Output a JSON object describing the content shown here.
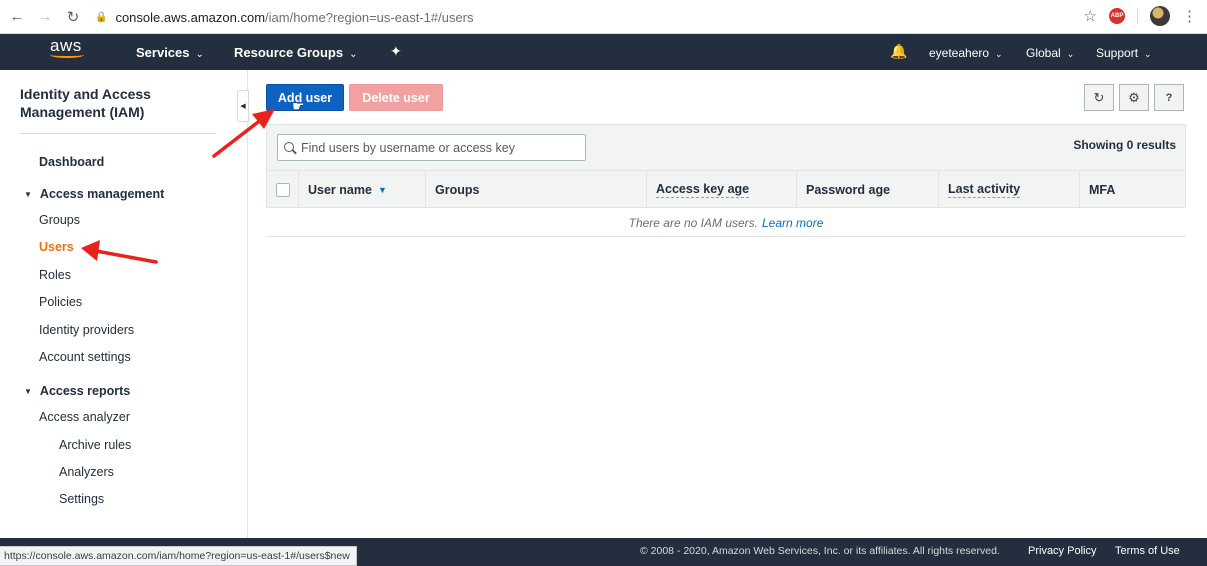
{
  "browser": {
    "url_host": "console.aws.amazon.com",
    "url_path": "/iam/home?region=us-east-1#/users",
    "status_url": "https://console.aws.amazon.com/iam/home?region=us-east-1#/users$new",
    "abp_label": "ABP"
  },
  "nav": {
    "logo": "aws",
    "services": "Services",
    "resource_groups": "Resource Groups",
    "account": "eyeteahero",
    "region": "Global",
    "support": "Support"
  },
  "sidebar": {
    "title": "Identity and Access Management (IAM)",
    "dashboard": "Dashboard",
    "access_management": "Access management",
    "items": [
      "Groups",
      "Users",
      "Roles",
      "Policies",
      "Identity providers",
      "Account settings"
    ],
    "access_reports": "Access reports",
    "analyzer": "Access analyzer",
    "analyzer_items": [
      "Archive rules",
      "Analyzers",
      "Settings"
    ],
    "active_item": "Users"
  },
  "toolbar": {
    "add_user": "Add user",
    "delete_user": "Delete user"
  },
  "search": {
    "placeholder": "Find users by username or access key"
  },
  "results": "Showing 0 results",
  "table": {
    "columns": [
      "User name",
      "Groups",
      "Access key age",
      "Password age",
      "Last activity",
      "MFA"
    ],
    "empty_text": "There are no IAM users.",
    "learn_more": "Learn more"
  },
  "footer": {
    "copyright": "© 2008 - 2020, Amazon Web Services, Inc. or its affiliates. All rights reserved.",
    "privacy": "Privacy Policy",
    "terms": "Terms of Use"
  },
  "colors": {
    "nav_bg": "#232f3e",
    "primary": "#0c64c0",
    "danger_disabled": "#f3a0a0",
    "active_link": "#ec7211",
    "annotation_arrow": "#e8231b"
  }
}
